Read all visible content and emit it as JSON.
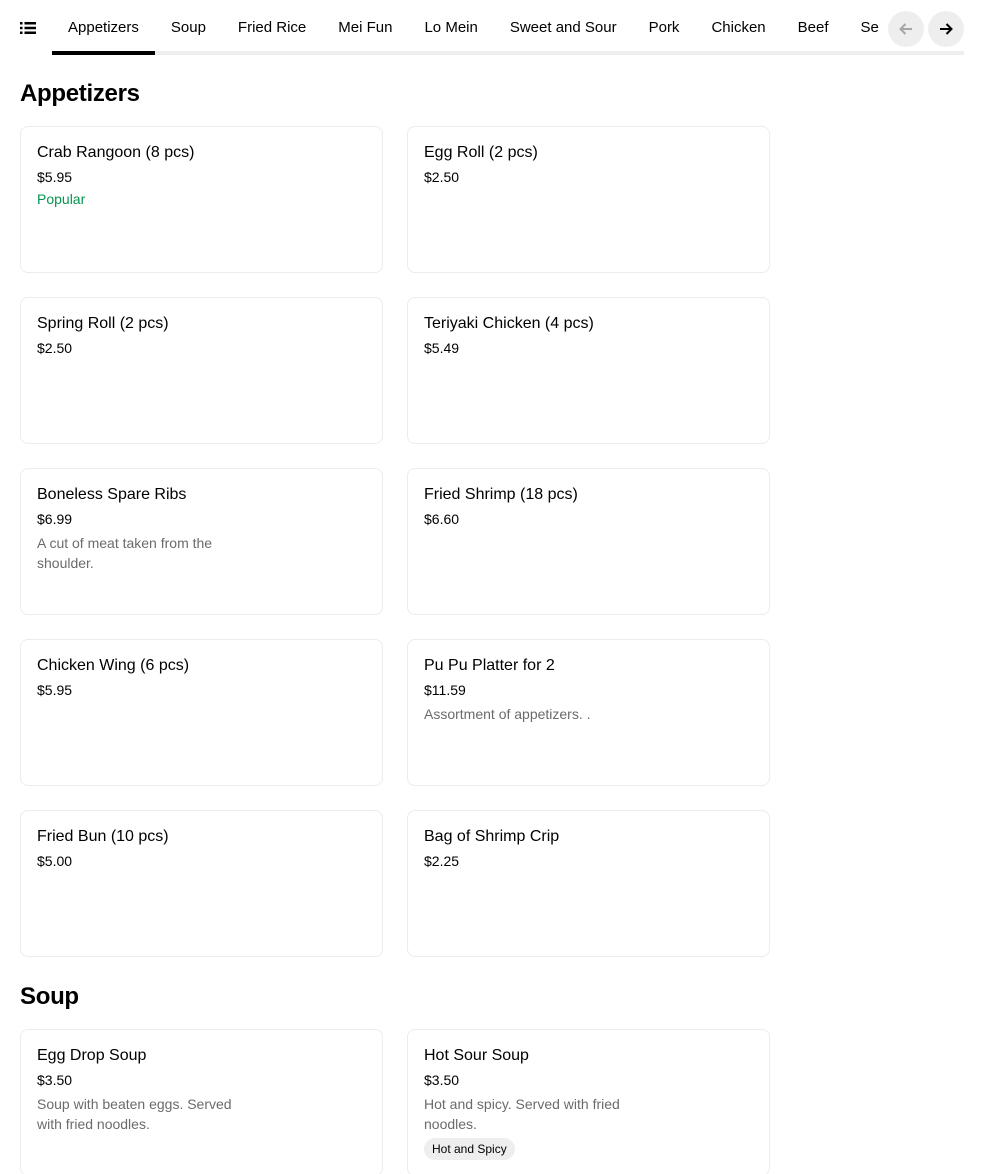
{
  "nav": {
    "menu_icon": "list-icon",
    "tabs": [
      {
        "label": "Appetizers"
      },
      {
        "label": "Soup"
      },
      {
        "label": "Fried Rice"
      },
      {
        "label": "Mei Fun"
      },
      {
        "label": "Lo Mein"
      },
      {
        "label": "Sweet and Sour"
      },
      {
        "label": "Pork"
      },
      {
        "label": "Chicken"
      },
      {
        "label": "Beef"
      },
      {
        "label": "Se"
      }
    ],
    "active_tab": "Appetizers",
    "prev_icon": "arrow-left-icon",
    "next_icon": "arrow-right-icon"
  },
  "sections": [
    {
      "title": "Appetizers",
      "items": [
        {
          "name": "Crab Rangoon (8 pcs)",
          "price": "$5.95",
          "badge": "Popular"
        },
        {
          "name": "Egg Roll (2 pcs)",
          "price": "$2.50"
        },
        {
          "name": "Spring Roll (2 pcs)",
          "price": "$2.50"
        },
        {
          "name": "Teriyaki Chicken (4 pcs)",
          "price": "$5.49"
        },
        {
          "name": "Boneless Spare Ribs",
          "price": "$6.99",
          "description": "A cut of meat taken from the shoulder."
        },
        {
          "name": "Fried Shrimp (18 pcs)",
          "price": "$6.60"
        },
        {
          "name": "Chicken Wing (6 pcs)",
          "price": "$5.95"
        },
        {
          "name": "Pu Pu Platter for 2",
          "price": "$11.59",
          "description": "Assortment of appetizers. ."
        },
        {
          "name": "Fried Bun (10 pcs)",
          "price": "$5.00"
        },
        {
          "name": "Bag of Shrimp Crip",
          "price": "$2.25"
        }
      ]
    },
    {
      "title": "Soup",
      "items": [
        {
          "name": "Egg Drop Soup",
          "price": "$3.50",
          "description": "Soup with beaten eggs. Served with fried noodles."
        },
        {
          "name": "Hot Sour Soup",
          "price": "$3.50",
          "description": "Hot and spicy. Served with fried noodles.",
          "tag": "Hot and Spicy"
        }
      ]
    }
  ],
  "colors": {
    "popular": "#05944f",
    "description": "#6b6b6b",
    "chip_bg": "#eeeeee",
    "card_border": "#ececec"
  }
}
